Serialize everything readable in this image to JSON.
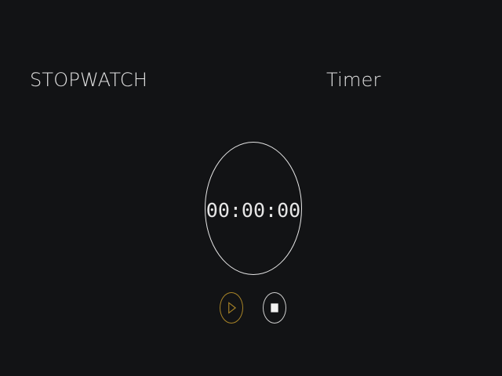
{
  "tabs": {
    "stopwatch_label": "STOPWATCH",
    "timer_label": "Timer"
  },
  "stopwatch": {
    "time": "00:00:00"
  },
  "controls": {
    "play_icon": "play-icon",
    "stop_icon": "stop-icon"
  },
  "colors": {
    "background": "#121315",
    "text": "#e2e2e2",
    "play_accent": "#a88427",
    "stop_accent": "#cfcfcf"
  }
}
